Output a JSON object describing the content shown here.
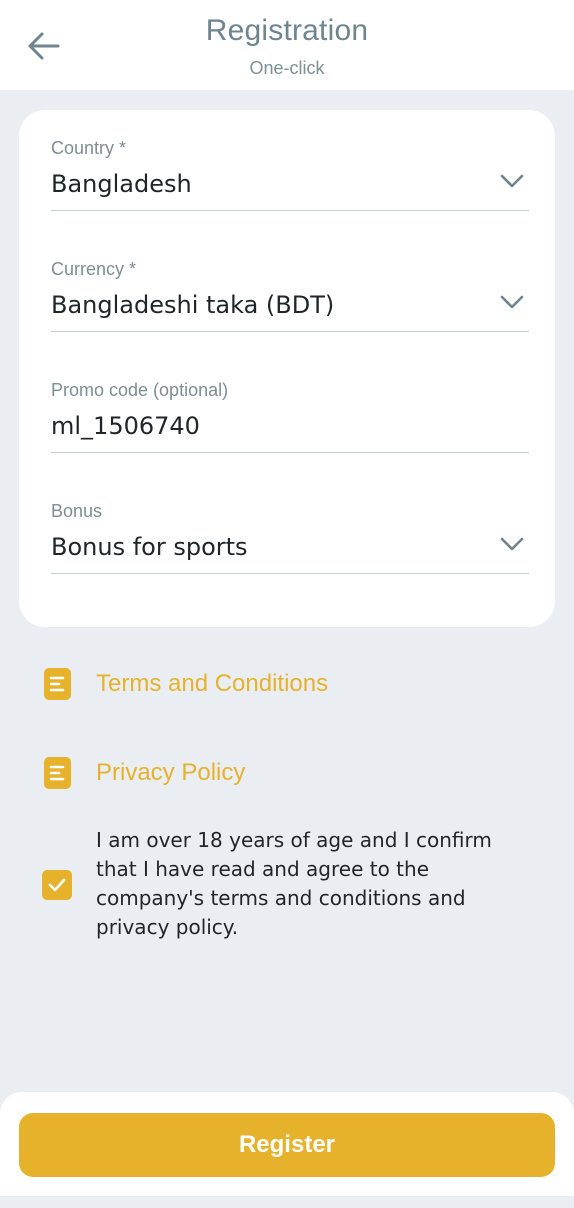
{
  "header": {
    "title": "Registration",
    "subtitle": "One-click",
    "back_icon": "arrow-left-icon"
  },
  "form": {
    "country": {
      "label": "Country *",
      "value": "Bangladesh"
    },
    "currency": {
      "label": "Currency *",
      "value": "Bangladeshi taka (BDT)"
    },
    "promo": {
      "label": "Promo code (optional)",
      "value": "ml_1506740"
    },
    "bonus": {
      "label": "Bonus",
      "value": "Bonus for sports"
    }
  },
  "links": {
    "terms": "Terms and Conditions",
    "privacy": "Privacy Policy"
  },
  "consent": {
    "checked": true,
    "text": "I am over 18 years of age and I confirm that I have read and agree to the company's terms and conditions and privacy policy."
  },
  "footer": {
    "register_label": "Register"
  },
  "colors": {
    "accent": "#e6b22c",
    "background": "#eaedf2",
    "card": "#ffffff",
    "title": "#6e8590"
  }
}
